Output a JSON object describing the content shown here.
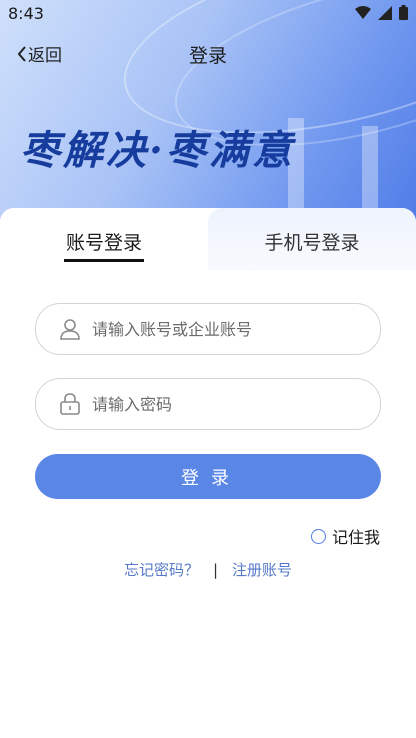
{
  "status_bar": {
    "time": "8:43"
  },
  "nav": {
    "back_label": "返回",
    "title": "登录"
  },
  "hero": {
    "slogan": "枣解决·枣满意"
  },
  "tabs": [
    {
      "label": "账号登录",
      "active": true
    },
    {
      "label": "手机号登录",
      "active": false
    }
  ],
  "form": {
    "account_placeholder": "请输入账号或企业账号",
    "password_placeholder": "请输入密码",
    "submit_label": "登录",
    "remember_label": "记住我"
  },
  "links": {
    "forgot": "忘记密码？",
    "separator": "|",
    "register": "注册账号"
  },
  "colors": {
    "primary": "#5a86e6",
    "link": "#5579c8",
    "hero_dark": "#163c9d"
  },
  "icons": [
    "wifi-icon",
    "signal-icon",
    "battery-icon",
    "chevron-left-icon",
    "user-icon",
    "lock-icon"
  ]
}
